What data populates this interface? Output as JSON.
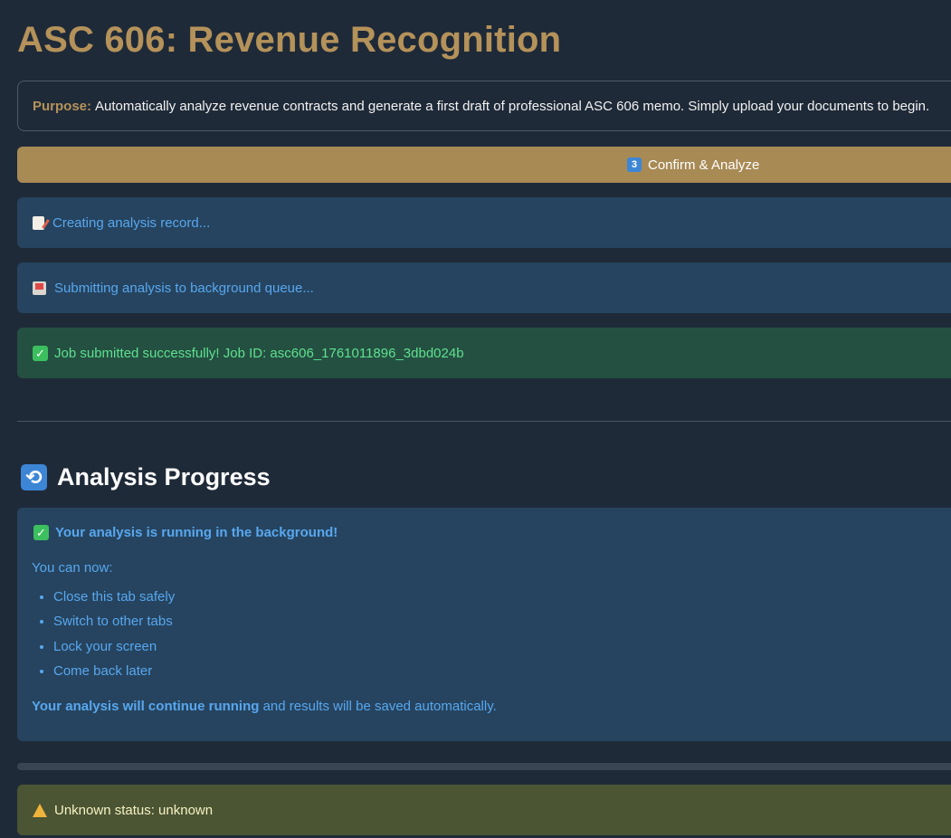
{
  "page": {
    "title": "ASC 606: Revenue Recognition"
  },
  "purpose": {
    "label": "Purpose:",
    "text": "Automatically analyze revenue contracts and generate a first draft of professional ASC 606 memo. Simply upload your documents to begin."
  },
  "confirm_button": {
    "step": "3",
    "label": "Confirm & Analyze"
  },
  "status_messages": {
    "creating": "Creating analysis record...",
    "submitting": "Submitting analysis to background queue...",
    "submitted": "Job submitted successfully! Job ID: asc606_1761011896_3dbd024b",
    "unknown": "Unknown status: unknown"
  },
  "progress_section": {
    "heading": "Analysis Progress",
    "running_title": "Your analysis is running in the background!",
    "you_can_now": "You can now:",
    "options": [
      "Close this tab safely",
      "Switch to other tabs",
      "Lock your screen",
      "Come back later"
    ],
    "continue_bold": "Your analysis will continue running",
    "continue_rest": " and results will be saved automatically.",
    "progress_fraction": 0
  },
  "icons": {
    "creating": "memo-icon",
    "submitting": "outbox-tray-icon",
    "submitted": "check-mark-icon",
    "heading": "refresh-icon",
    "warning": "warning-icon"
  },
  "colors": {
    "background": "#1f2a38",
    "accent": "#b4925a",
    "button": "#a88a55",
    "info_bg": "#26445f",
    "info_text": "#58a7ef",
    "success_bg": "#245041",
    "success_text": "#5ee08f",
    "warning_bg": "#4b5433",
    "warning_text": "#f6f3c2"
  }
}
